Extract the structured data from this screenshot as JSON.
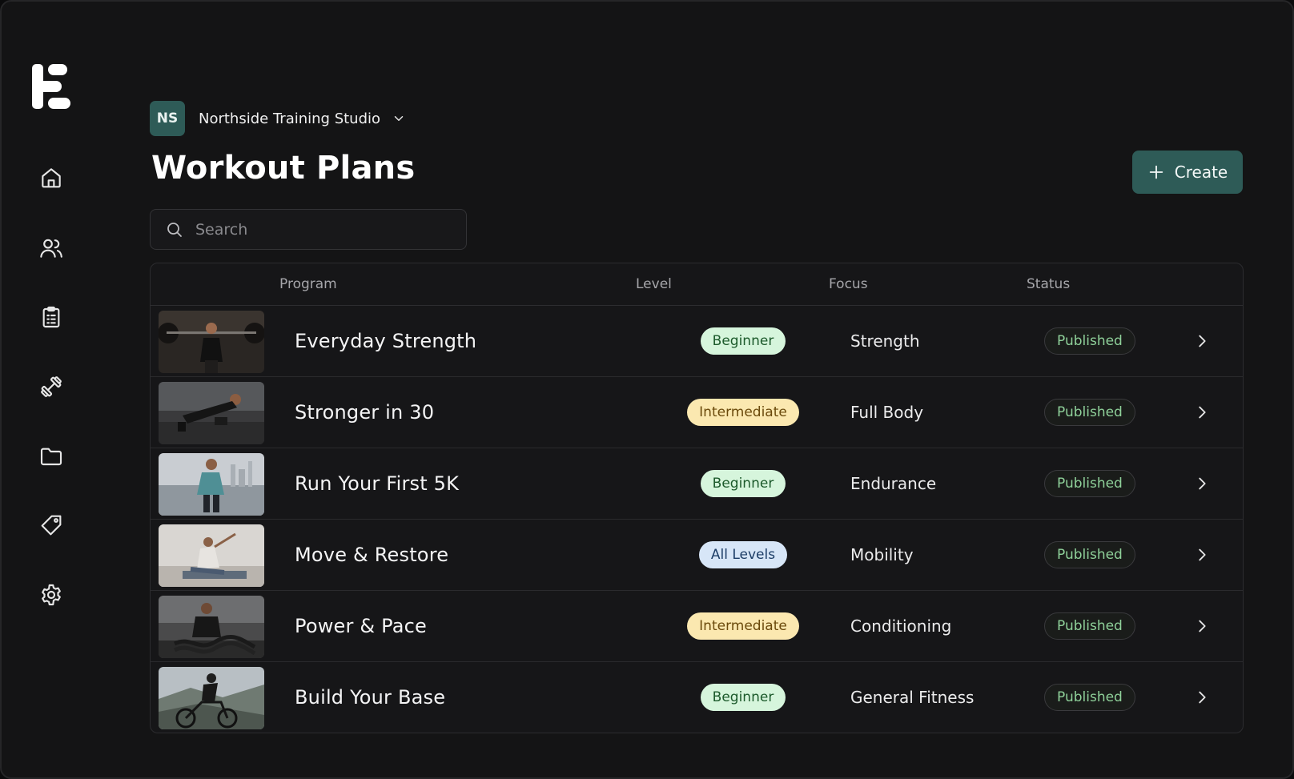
{
  "workspace": {
    "initials": "NS",
    "name": "Northside Training Studio"
  },
  "page": {
    "title": "Workout Plans"
  },
  "actions": {
    "create_label": "Create"
  },
  "search": {
    "placeholder": "Search",
    "value": ""
  },
  "sidebar": {
    "items": [
      {
        "icon": "home-icon"
      },
      {
        "icon": "users-icon"
      },
      {
        "icon": "clipboard-icon"
      },
      {
        "icon": "dumbbell-icon"
      },
      {
        "icon": "folder-icon"
      },
      {
        "icon": "tag-icon"
      },
      {
        "icon": "gear-icon"
      }
    ]
  },
  "table": {
    "columns": {
      "program": "Program",
      "level": "Level",
      "focus": "Focus",
      "status": "Status"
    },
    "rows": [
      {
        "program": "Everyday Strength",
        "level": "Beginner",
        "level_kind": "beginner",
        "focus": "Strength",
        "status": "Published"
      },
      {
        "program": "Stronger in 30",
        "level": "Intermediate",
        "level_kind": "intermediate",
        "focus": "Full Body",
        "status": "Published"
      },
      {
        "program": "Run Your First 5K",
        "level": "Beginner",
        "level_kind": "beginner",
        "focus": "Endurance",
        "status": "Published"
      },
      {
        "program": "Move & Restore",
        "level": "All Levels",
        "level_kind": "all-levels",
        "focus": "Mobility",
        "status": "Published"
      },
      {
        "program": "Power & Pace",
        "level": "Intermediate",
        "level_kind": "intermediate",
        "focus": "Conditioning",
        "status": "Published"
      },
      {
        "program": "Build Your Base",
        "level": "Beginner",
        "level_kind": "beginner",
        "focus": "General Fitness",
        "status": "Published"
      }
    ]
  },
  "colors": {
    "accent": "#2e5b57",
    "background": "#141415",
    "status_published": "#8fd19a",
    "badge_beginner": "#d6f5dc",
    "badge_intermediate": "#fbe8b0",
    "badge_all_levels": "#d7e6f7"
  }
}
